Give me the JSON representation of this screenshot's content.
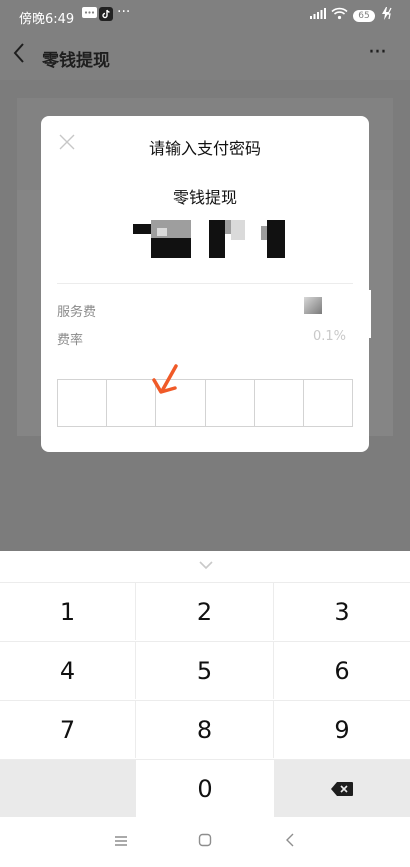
{
  "status_bar": {
    "time": "傍晚6:49",
    "battery": "65"
  },
  "nav": {
    "title": "零钱提现"
  },
  "dialog": {
    "title": "请输入支付密码",
    "subtitle": "零钱提现",
    "service_fee_label": "服务费",
    "rate_label": "费率",
    "rate_value": "0.1%",
    "pin_length": 6
  },
  "keypad": {
    "keys": [
      "1",
      "2",
      "3",
      "4",
      "5",
      "6",
      "7",
      "8",
      "9",
      "",
      "0",
      "⌫"
    ]
  },
  "colors": {
    "accent_arrow": "#f05a28",
    "dim_overlay": "#808080"
  }
}
